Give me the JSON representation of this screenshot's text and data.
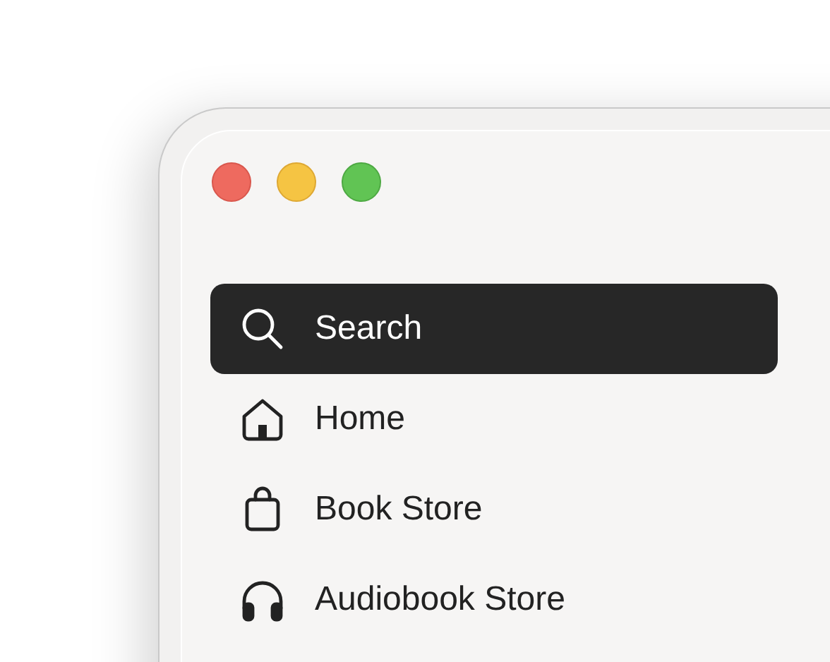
{
  "sidebar": {
    "items": [
      {
        "label": "Search",
        "selected": true
      },
      {
        "label": "Home",
        "selected": false
      },
      {
        "label": "Book Store",
        "selected": false
      },
      {
        "label": "Audiobook Store",
        "selected": false
      }
    ]
  }
}
